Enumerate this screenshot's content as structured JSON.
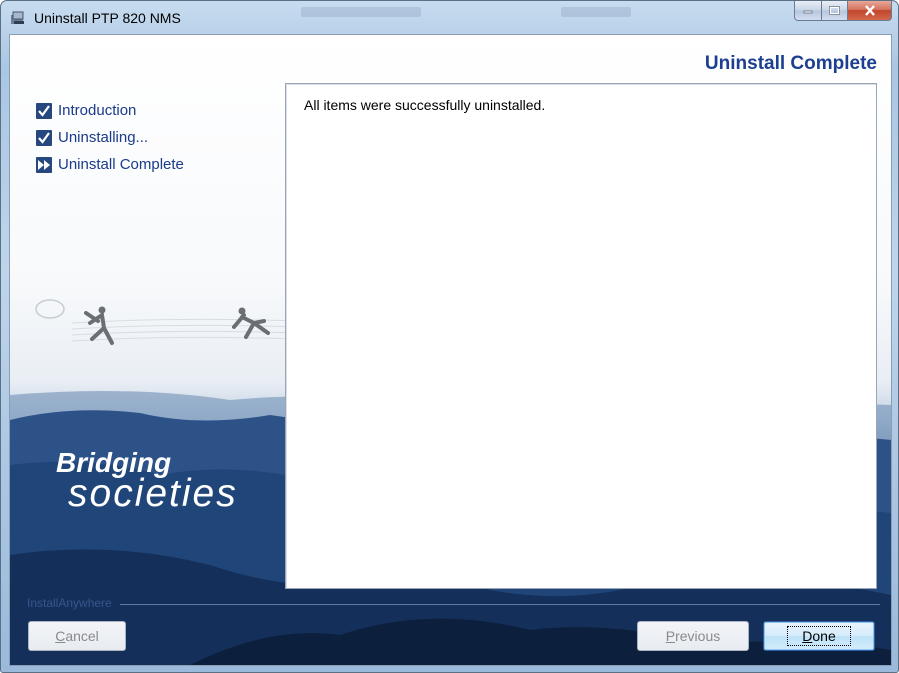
{
  "window": {
    "title": "Uninstall PTP 820 NMS",
    "controls": {
      "minimize_icon": "minimize-icon",
      "maximize_icon": "maximize-icon",
      "close_icon": "close-icon"
    }
  },
  "header": {
    "title": "Uninstall Complete"
  },
  "steps": [
    {
      "label": "Introduction",
      "state": "done",
      "icon": "checkmark-icon"
    },
    {
      "label": "Uninstalling...",
      "state": "done",
      "icon": "checkmark-icon"
    },
    {
      "label": "Uninstall Complete",
      "state": "current",
      "icon": "fast-forward-icon"
    }
  ],
  "content": {
    "message": "All items were successfully uninstalled."
  },
  "branding": {
    "line1": "Bridging",
    "line2": "societies",
    "footer": "InstallAnywhere"
  },
  "buttons": {
    "cancel": {
      "mnemonic": "C",
      "rest": "ancel",
      "enabled": false
    },
    "previous": {
      "mnemonic": "P",
      "rest": "revious",
      "enabled": false
    },
    "done": {
      "mnemonic": "D",
      "rest": "one",
      "enabled": true,
      "default": true
    }
  },
  "colors": {
    "accent": "#1c3f91",
    "step_text": "#1a3a8a",
    "default_button_border": "#2f5ea5"
  }
}
